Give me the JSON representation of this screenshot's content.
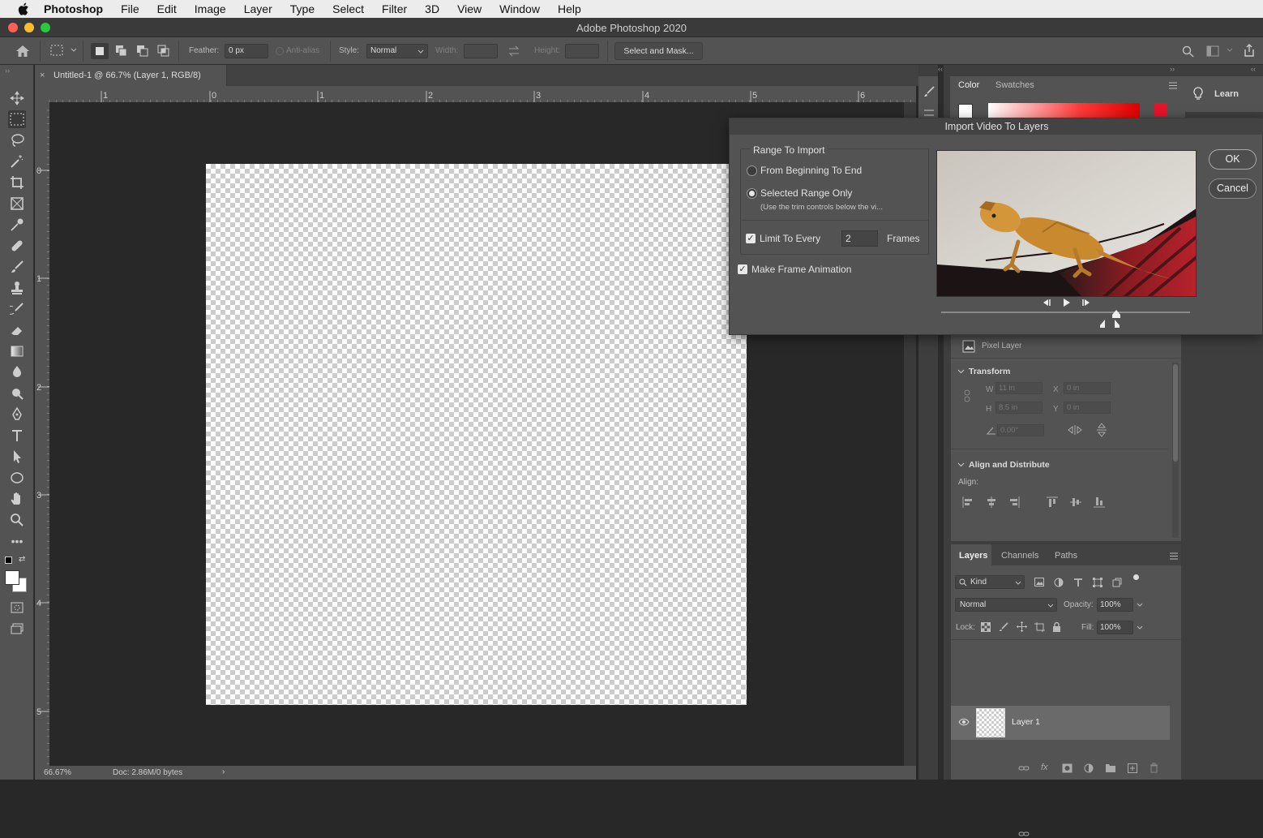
{
  "menubar": {
    "app": "Photoshop",
    "items": [
      "File",
      "Edit",
      "Image",
      "Layer",
      "Type",
      "Select",
      "Filter",
      "3D",
      "View",
      "Window",
      "Help"
    ]
  },
  "window": {
    "title": "Adobe Photoshop 2020"
  },
  "options": {
    "feather_label": "Feather:",
    "feather_value": "0 px",
    "antialias_label": "Anti-alias",
    "style_label": "Style:",
    "style_value": "Normal",
    "width_label": "Width:",
    "height_label": "Height:",
    "select_mask": "Select and Mask..."
  },
  "document": {
    "tab_title": "Untitled-1 @ 66.7% (Layer 1, RGB/8)",
    "zoom": "66.67%",
    "doc_info": "Doc: 2.86M/0 bytes",
    "ruler_h": [
      "1",
      "0",
      "1",
      "2",
      "3",
      "4",
      "5",
      "6"
    ],
    "ruler_v": [
      "0",
      "1",
      "2",
      "3",
      "4",
      "5"
    ]
  },
  "color_panel": {
    "tabs": [
      "Color",
      "Swatches"
    ]
  },
  "learn": {
    "label": "Learn"
  },
  "properties": {
    "kind": "Pixel Layer",
    "transform_title": "Transform",
    "w_label": "W",
    "w_value": "11 in",
    "h_label": "H",
    "h_value": "8.5 in",
    "x_label": "X",
    "x_value": "0 in",
    "y_label": "Y",
    "y_value": "0 in",
    "angle_value": "0.00°",
    "align_title": "Align and Distribute",
    "align_label": "Align:"
  },
  "layers_panel": {
    "tabs": [
      "Layers",
      "Channels",
      "Paths"
    ],
    "filter_kind": "Kind",
    "blend_mode": "Normal",
    "opacity_label": "Opacity:",
    "opacity_value": "100%",
    "lock_label": "Lock:",
    "fill_label": "Fill:",
    "fill_value": "100%",
    "layers": [
      {
        "name": "Layer 1"
      }
    ]
  },
  "dialog": {
    "title": "Import Video To Layers",
    "group_label": "Range To Import",
    "option_all": "From Beginning To End",
    "option_selected": "Selected Range Only",
    "selected_hint": "(Use the trim controls below the vi...",
    "selected_range_checked": true,
    "limit_label": "Limit To Every",
    "limit_value": "2",
    "frames_label": "Frames",
    "limit_checked": true,
    "make_animation_label": "Make Frame Animation",
    "make_animation_checked": true,
    "ok": "OK",
    "cancel": "Cancel"
  }
}
